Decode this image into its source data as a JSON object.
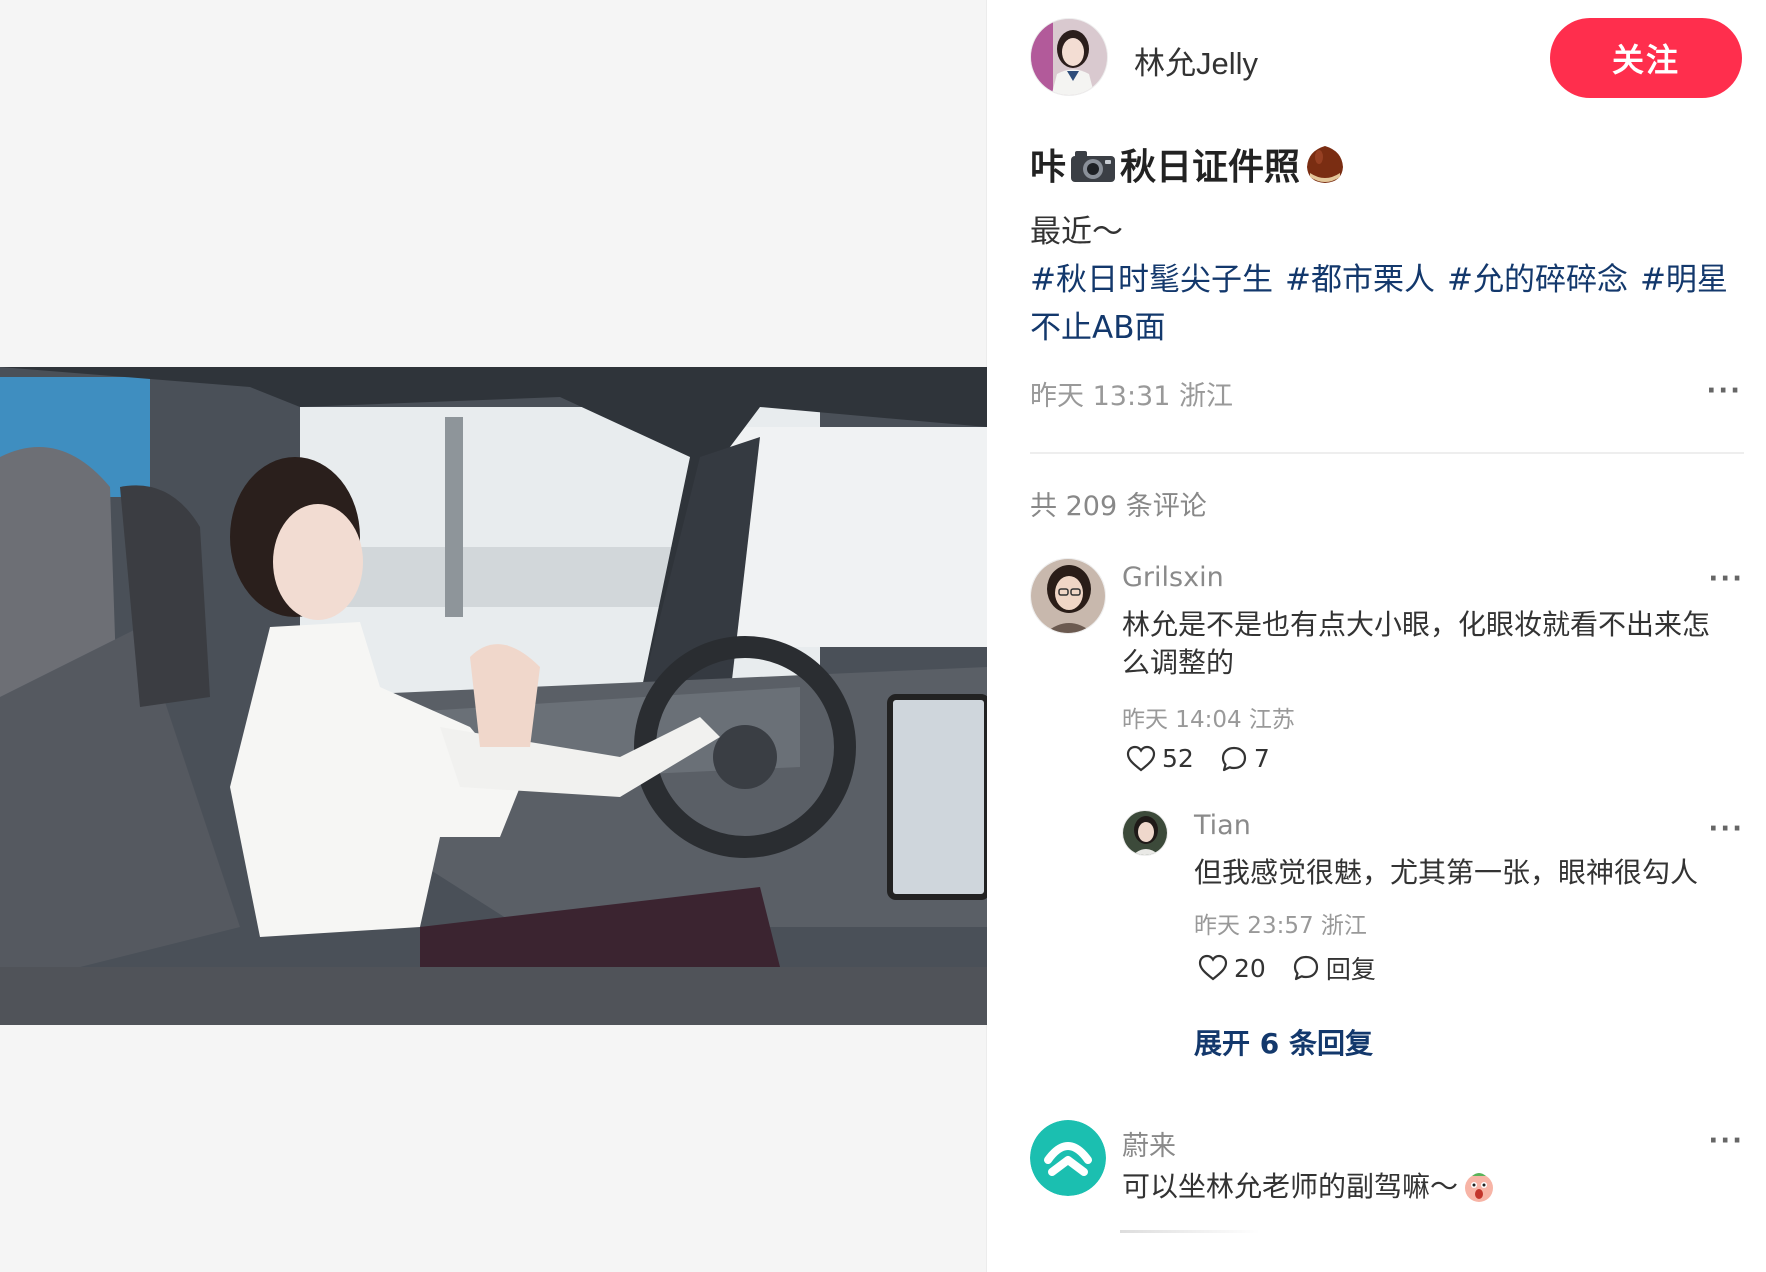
{
  "author": {
    "name": "林允Jelly",
    "follow_label": "关注"
  },
  "note": {
    "title_prefix": "咔",
    "title_main": "秋日证件照",
    "title_icons": [
      "camera-icon",
      "chestnut-icon"
    ],
    "body": "最近～",
    "tags": [
      "#秋日时髦尖子生",
      "#都市栗人",
      "#允的碎碎念",
      "#明星不止AB面"
    ],
    "meta": "昨天 13:31 浙江",
    "more_label": "···"
  },
  "comments_header": "共 209 条评论",
  "comments": [
    {
      "user": "Grilsxin",
      "text": "林允是不是也有点大小眼，化眼妆就看不出来怎么调整的",
      "meta": "昨天 14:04 江苏",
      "likes": "52",
      "replies_count": "7",
      "more_label": "···",
      "reply": {
        "user": "Tian",
        "text": "但我感觉很魅，尤其第一张，眼神很勾人",
        "meta": "昨天 23:57 浙江",
        "likes": "20",
        "reply_label": "回复",
        "more_label": "···"
      },
      "expand_label": "展开 6 条回复"
    },
    {
      "user": "蔚来",
      "text": "可以坐林允老师的副驾嘛～",
      "text_icon": "surprised-face-icon",
      "more_label": "···"
    }
  ],
  "colors": {
    "follow_button": "#ff2e4d",
    "tag_link": "#13386c",
    "meta_gray": "#999999",
    "nio_brand": "#1bbfb0"
  }
}
